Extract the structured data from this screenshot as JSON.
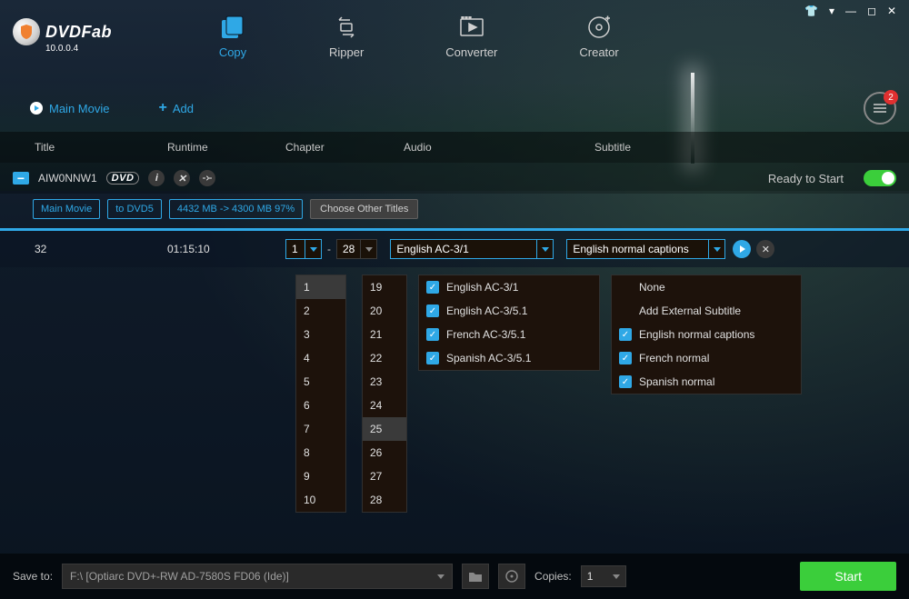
{
  "app": {
    "name": "DVDFab",
    "version": "10.0.0.4"
  },
  "window_controls": {
    "shirt": "👕",
    "dropdown": "▾",
    "minimize": "—",
    "maximize": "◻",
    "close": "✕"
  },
  "modes": {
    "copy": "Copy",
    "ripper": "Ripper",
    "converter": "Converter",
    "creator": "Creator"
  },
  "toolbar": {
    "main_movie": "Main Movie",
    "add": "Add",
    "queue_count": "2"
  },
  "columns": {
    "title": "Title",
    "runtime": "Runtime",
    "chapter": "Chapter",
    "audio": "Audio",
    "subtitle": "Subtitle"
  },
  "source": {
    "name": "AIW0NNW1",
    "ready": "Ready to Start"
  },
  "tags": {
    "main_movie": "Main Movie",
    "to_dvd5": "to DVD5",
    "size": "4432 MB -> 4300 MB 97%",
    "choose_other": "Choose Other Titles"
  },
  "track": {
    "number": "32",
    "runtime": "01:15:10",
    "chapter_from": "1",
    "chapter_to": "28",
    "audio_selected": "English AC-3/1",
    "subtitle_selected": "English normal captions"
  },
  "chapter_from_options": [
    "1",
    "2",
    "3",
    "4",
    "5",
    "6",
    "7",
    "8",
    "9",
    "10"
  ],
  "chapter_to_options": [
    "19",
    "20",
    "21",
    "22",
    "23",
    "24",
    "25",
    "26",
    "27",
    "28"
  ],
  "chapter_to_highlight": "25",
  "audio_options": [
    {
      "label": "English AC-3/1",
      "checked": true
    },
    {
      "label": "English AC-3/5.1",
      "checked": true
    },
    {
      "label": "French AC-3/5.1",
      "checked": true
    },
    {
      "label": "Spanish AC-3/5.1",
      "checked": true
    }
  ],
  "subtitle_options": [
    {
      "label": "None",
      "checked": false,
      "nochk": true
    },
    {
      "label": "Add External Subtitle",
      "checked": false,
      "nochk": true
    },
    {
      "label": "English normal captions",
      "checked": true
    },
    {
      "label": "French normal",
      "checked": true
    },
    {
      "label": "Spanish normal",
      "checked": true
    }
  ],
  "footer": {
    "save_to_label": "Save to:",
    "save_to_value": "F:\\ [Optiarc DVD+-RW AD-7580S FD06 (Ide)]",
    "copies_label": "Copies:",
    "copies_value": "1",
    "start": "Start"
  }
}
